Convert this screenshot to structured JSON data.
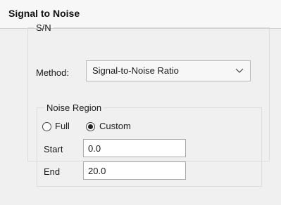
{
  "header": {
    "title": "Signal to Noise"
  },
  "sn_group": {
    "legend": "S/N",
    "method_label": "Method:",
    "method_value": "Signal-to-Noise Ratio",
    "dropdown_icon": "chevron-down-icon"
  },
  "noise_region": {
    "legend": "Noise Region",
    "options": [
      {
        "label": "Full",
        "selected": false
      },
      {
        "label": "Custom",
        "selected": true
      }
    ],
    "start_label": "Start",
    "start_value": "0.0",
    "end_label": "End",
    "end_value": "20.0"
  }
}
